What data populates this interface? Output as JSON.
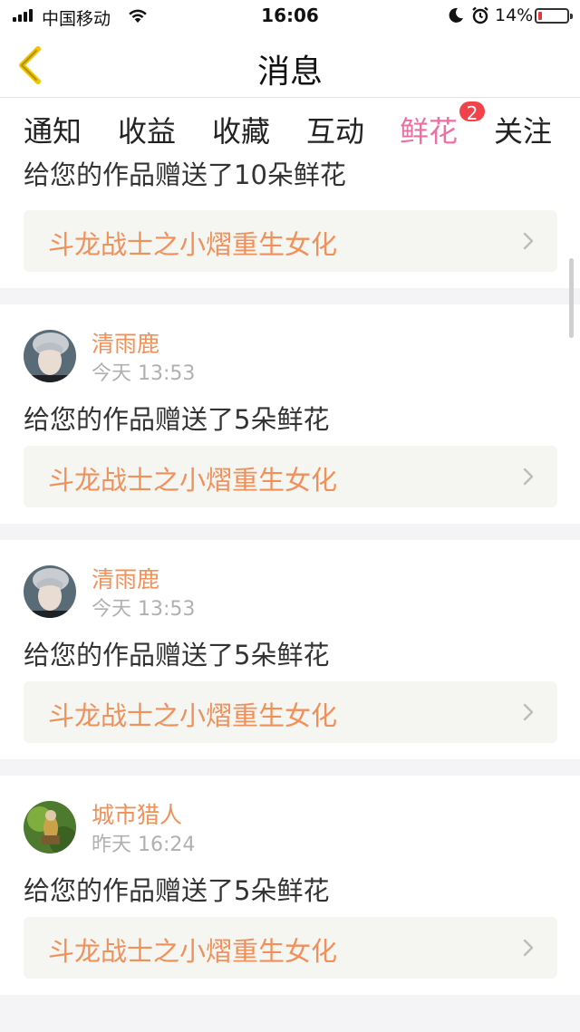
{
  "status_bar": {
    "carrier": "中国移动",
    "time": "16:06",
    "battery_percent": "14%",
    "battery_level": 0.14,
    "icons": [
      "signal-icon",
      "wifi-icon",
      "moon-icon",
      "alarm-icon",
      "battery-icon"
    ]
  },
  "nav": {
    "title": "消息",
    "back_icon": "chevron-left-icon"
  },
  "tabs": [
    {
      "label": "通知"
    },
    {
      "label": "收益"
    },
    {
      "label": "收藏"
    },
    {
      "label": "互动"
    },
    {
      "label": "鲜花",
      "badge": "2",
      "active": true
    },
    {
      "label": "关注"
    }
  ],
  "messages": [
    {
      "text": "给您的作品赠送了10朵鲜花",
      "work_title": "斗龙战士之小熠重生女化"
    },
    {
      "user": "清雨鹿",
      "time": "今天 13:53",
      "text": "给您的作品赠送了5朵鲜花",
      "work_title": "斗龙战士之小熠重生女化"
    },
    {
      "user": "清雨鹿",
      "time": "今天 13:53",
      "text": "给您的作品赠送了5朵鲜花",
      "work_title": "斗龙战士之小熠重生女化"
    },
    {
      "user": "城市猎人",
      "time": "昨天 16:24",
      "text": "给您的作品赠送了5朵鲜花",
      "work_title": "斗龙战士之小熠重生女化"
    }
  ],
  "colors": {
    "accent": "#ec6fa2",
    "badge": "#f14349",
    "username": "#f0905a",
    "work_title": "#f0905a",
    "timestamp": "#b0b0b0"
  }
}
